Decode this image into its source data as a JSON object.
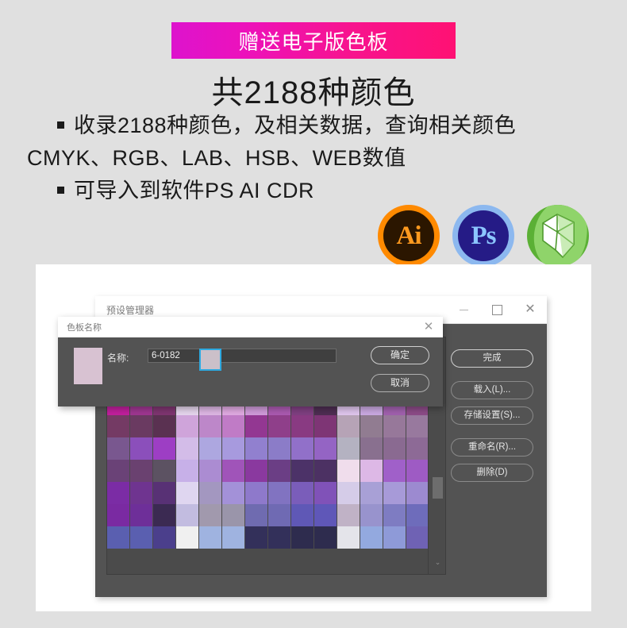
{
  "promo": {
    "banner_text": "赠送电子版色板",
    "banner_gradient_from": "#dd13cd",
    "banner_gradient_to": "#ff1173",
    "headline": "共2188种颜色",
    "bullets": [
      "收录2188种颜色，及相关数据，查询相关颜色",
      "CMYK、RGB、LAB、HSB、WEB数值",
      "可导入到软件PS AI CDR"
    ],
    "logos": [
      {
        "name": "illustrator-logo",
        "glyph": "Ai",
        "ring": "#ff8a00",
        "fill": "#2b1600",
        "text": "#ff9a1f"
      },
      {
        "name": "photoshop-logo",
        "glyph": "Ps",
        "ring": "#8cb8ef",
        "fill": "#251b86",
        "text": "#8cc6ff"
      },
      {
        "name": "coreldraw-logo",
        "glyph": "",
        "ring": "#5bb035",
        "fill": "#5bb035",
        "text": "#ffffff"
      }
    ]
  },
  "preset_manager": {
    "title": "预设管理器",
    "window_controls": [
      {
        "name": "minimize-button",
        "symbol": "—"
      },
      {
        "name": "maximize-button",
        "symbol": "□"
      },
      {
        "name": "close-button",
        "symbol": "✕"
      }
    ],
    "buttons": [
      {
        "label": "完成",
        "primary": true
      },
      {
        "label": "载入(L)...",
        "primary": false
      },
      {
        "label": "存储设置(S)...",
        "primary": false
      },
      {
        "label": "重命名(R)...",
        "primary": false
      },
      {
        "label": "删除(D)",
        "primary": false
      }
    ],
    "scrollbar": {
      "arrow": "⌄"
    }
  },
  "swatch_dialog": {
    "title": "色板名称",
    "close_symbol": "✕",
    "preview_color": "#d8c2d2",
    "name_label": "名称:",
    "name_value": "6-0182",
    "name_placeholder": "名称",
    "ok_label": "确定",
    "cancel_label": "取消"
  },
  "swatch_grid": {
    "columns": 14,
    "selected_index": {
      "row": 1,
      "col": 4
    },
    "selection_color": "#2ea9e0",
    "rows": [
      [
        "#6a2f5c",
        "#7a2f63",
        "#5e2547",
        "#8e7f88",
        "#8e7f88",
        "#8a4f7c",
        "#8d4a7f",
        "#6f4c66",
        "#72445f",
        "#5a3148",
        "#97928f",
        "#8e7785",
        "#8b6f84",
        "#8a5f7d"
      ],
      [
        "#6c3a5c",
        "#6b3558",
        "#4e2739",
        "#ddd3d6",
        "#cbc0c9",
        "#cfc4cd",
        "#b8a4b6",
        "#9c7f97",
        "#8f6e8a",
        "#4b2b3c",
        "#ded2e2",
        "#c3acc6",
        "#c0a7c4",
        "#a98bb4"
      ],
      [
        "#6d4769",
        "#5f3b57",
        "#553052",
        "#e4dcde",
        "#b6a2b8",
        "#e0a4d8",
        "#b192bd",
        "#b484ba",
        "#b052b3",
        "#a93fa6",
        "#e9b7e4",
        "#e07fd2",
        "#c32ab0",
        "#c128ab"
      ],
      [
        "#c01f9c",
        "#9e3690",
        "#7e3570",
        "#e5d5ec",
        "#ddb6e3",
        "#dfa9e0",
        "#cf9ad9",
        "#aa5ab0",
        "#7e3f80",
        "#4e2d52",
        "#dec4ec",
        "#c9a8e0",
        "#a060ad",
        "#8c4b87"
      ],
      [
        "#743a64",
        "#6a3a61",
        "#5a3151",
        "#cfa4da",
        "#bd87c9",
        "#c07bc6",
        "#933792",
        "#8f3f8a",
        "#893a82",
        "#7e3575",
        "#b6a3b6",
        "#917c91",
        "#97789a",
        "#98799e"
      ],
      [
        "#79578f",
        "#8b4fbb",
        "#9d3ec4",
        "#d3bce8",
        "#ada7e0",
        "#a79ade",
        "#9180cf",
        "#8b7cc8",
        "#9170c9",
        "#9464c4",
        "#b4b2c1",
        "#89708f",
        "#8a6a91",
        "#8d6a96"
      ],
      [
        "#6a4277",
        "#6a4170",
        "#5c5262",
        "#c7b0e8",
        "#ab8cd2",
        "#a054b9",
        "#8a399f",
        "#6b3e85",
        "#4c3268",
        "#4c3163",
        "#f0ddec",
        "#ddb8e6",
        "#a060c9",
        "#9e5bc4"
      ],
      [
        "#7b2ca5",
        "#6f3490",
        "#583175",
        "#dfd6f0",
        "#a397c0",
        "#a391d8",
        "#8e79cb",
        "#8173c1",
        "#7a5dba",
        "#8052b8",
        "#d5cce8",
        "#a8a0d6",
        "#a79ad8",
        "#9c8ad0"
      ],
      [
        "#7a2aa2",
        "#6e2f99",
        "#3b2a52",
        "#c2bce0",
        "#a199ad",
        "#9a95aa",
        "#6f6bb0",
        "#6f6ab3",
        "#5f58b6",
        "#5f57b8",
        "#c0b2c6",
        "#9893cd",
        "#7e7cc2",
        "#6e6cbb"
      ],
      [
        "#5a5fb0",
        "#5a5fb0",
        "#4b3f8c",
        "#f0f0f0",
        "#9fb3e0",
        "#9fb3e0",
        "#33305a",
        "#33305a",
        "#2e2c4e",
        "#2e2c4e",
        "#e4e4ea",
        "#93a9df",
        "#8e9ad8",
        "#6f62b4"
      ]
    ]
  }
}
